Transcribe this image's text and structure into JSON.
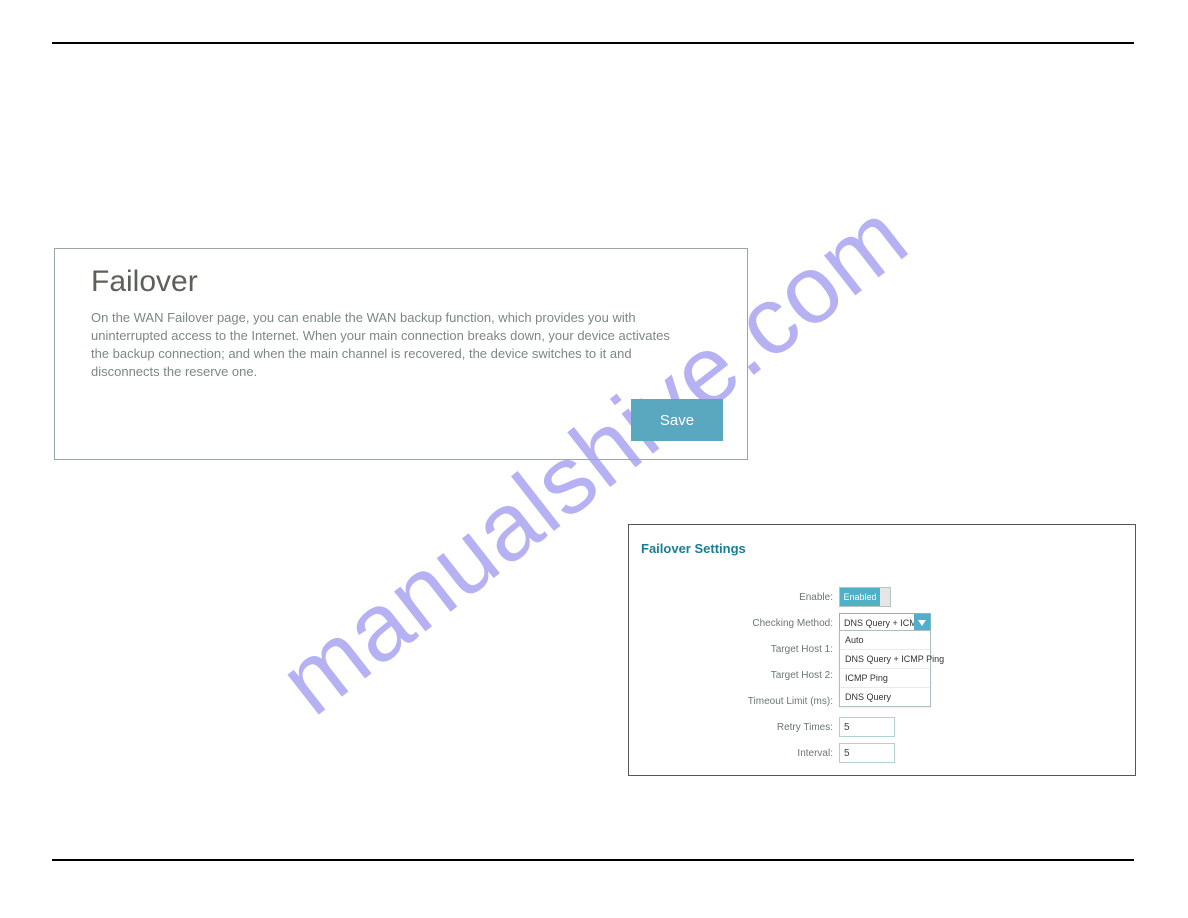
{
  "watermark": "manualshive.com",
  "failover_panel": {
    "title": "Failover",
    "description": "On the WAN Failover page, you can enable the WAN backup function, which provides you with uninterrupted access to the Internet. When your main connection breaks down, your device activates the backup connection; and when the main channel is recovered, the device switches to it and disconnects the reserve one.",
    "save_label": "Save"
  },
  "settings_panel": {
    "title": "Failover Settings",
    "labels": {
      "enable": "Enable:",
      "checking_method": "Checking Method:",
      "target_host1": "Target Host 1:",
      "target_host2": "Target Host 2:",
      "timeout": "Timeout Limit (ms):",
      "retry": "Retry Times:",
      "interval": "Interval:"
    },
    "values": {
      "enable_toggle": "Enabled",
      "checking_method_selected": "DNS Query + ICMP...",
      "retry": "5",
      "interval": "5"
    },
    "dropdown_options": [
      "Auto",
      "DNS Query + ICMP Ping",
      "ICMP Ping",
      "DNS Query"
    ]
  }
}
